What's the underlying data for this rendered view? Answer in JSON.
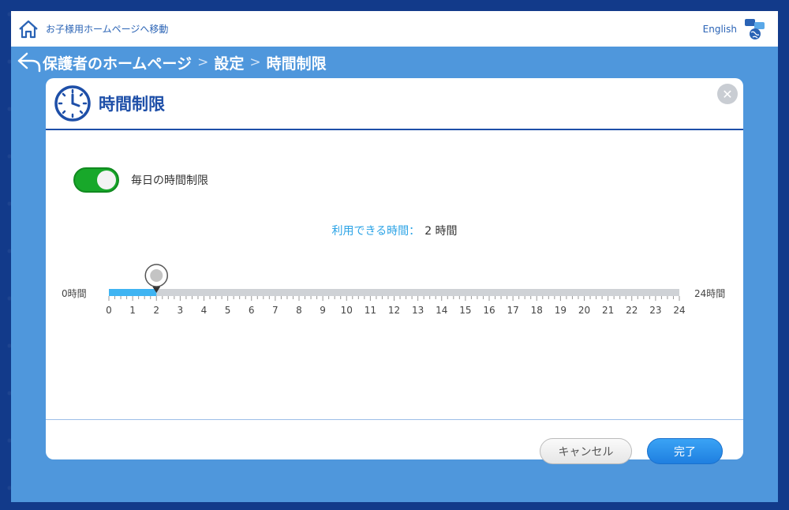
{
  "topbar": {
    "home_link_label": "お子様用ホームページへ移動",
    "language_label": "English"
  },
  "breadcrumb": {
    "items": [
      "保護者のホームページ",
      "設定",
      "時間制限"
    ],
    "separator": ">"
  },
  "dialog": {
    "title": "時間制限",
    "close_label": "✕",
    "toggle": {
      "label": "毎日の時間制限",
      "state": "on"
    },
    "available": {
      "label": "利用できる時間：",
      "value": "2 時間"
    },
    "slider": {
      "min_label": "0時間",
      "max_label": "24時間",
      "min": 0,
      "max": 24,
      "value": 2,
      "ticks": [
        "0",
        "1",
        "2",
        "3",
        "4",
        "5",
        "6",
        "7",
        "8",
        "9",
        "10",
        "11",
        "12",
        "13",
        "14",
        "15",
        "16",
        "17",
        "18",
        "19",
        "20",
        "21",
        "22",
        "23",
        "24"
      ]
    },
    "cancel_label": "キャンセル",
    "done_label": "完了"
  },
  "colors": {
    "accent_blue": "#1e4fa8",
    "toggle_green": "#18a82a",
    "slider_fill": "#3fb4f2",
    "background": "#4f97dc"
  }
}
